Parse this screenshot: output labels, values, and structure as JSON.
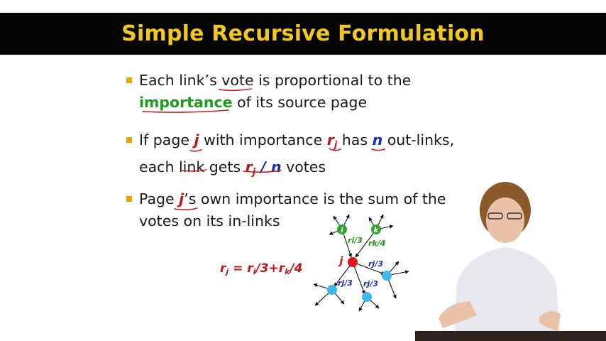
{
  "slide": {
    "title": "Simple Recursive Formulation",
    "bullet1": {
      "pre": "Each link’s vote is proportional to the",
      "emph": "importance",
      "post": " of its source page"
    },
    "bullet2": {
      "a": "If page ",
      "j": "j",
      "b": " with importance ",
      "r": "r",
      "rsub": "j",
      "c": " has ",
      "n": "n",
      "d": " out-links,",
      "e": "each link gets ",
      "f_r": "r",
      "f_sub": "j",
      "f_slash": " / n",
      "g": " votes"
    },
    "bullet3": {
      "a": "Page ",
      "j": "j",
      "b": "’s own importance is the sum of the",
      "c": "votes on its in-links"
    },
    "formula": {
      "lhs": "r",
      "lhs_sub": "j",
      "eq": " = ",
      "t1": "r",
      "t1_sub": "i",
      "t1_div": "/3+",
      "t2": "r",
      "t2_sub": "k",
      "t2_div": "/4"
    }
  },
  "graph": {
    "nodes": {
      "i": "i",
      "k": "k",
      "j": "j"
    },
    "edge_labels": {
      "i_to_j": "ri/3",
      "k_to_j": "rk/4",
      "j_out_1": "rj/3",
      "j_out_2": "rj/3",
      "j_out_3": "rj/3"
    },
    "colors": {
      "green": "#2fa52f",
      "red": "#e3161d",
      "blue": "#3fb7ea"
    }
  },
  "colors": {
    "title_text": "#f2c81a",
    "title_bg": "#050505",
    "bullet": "#e8a600",
    "emph_green": "#1f9a1f",
    "emph_red": "#c4151c",
    "emph_blue": "#1c2bb5"
  }
}
